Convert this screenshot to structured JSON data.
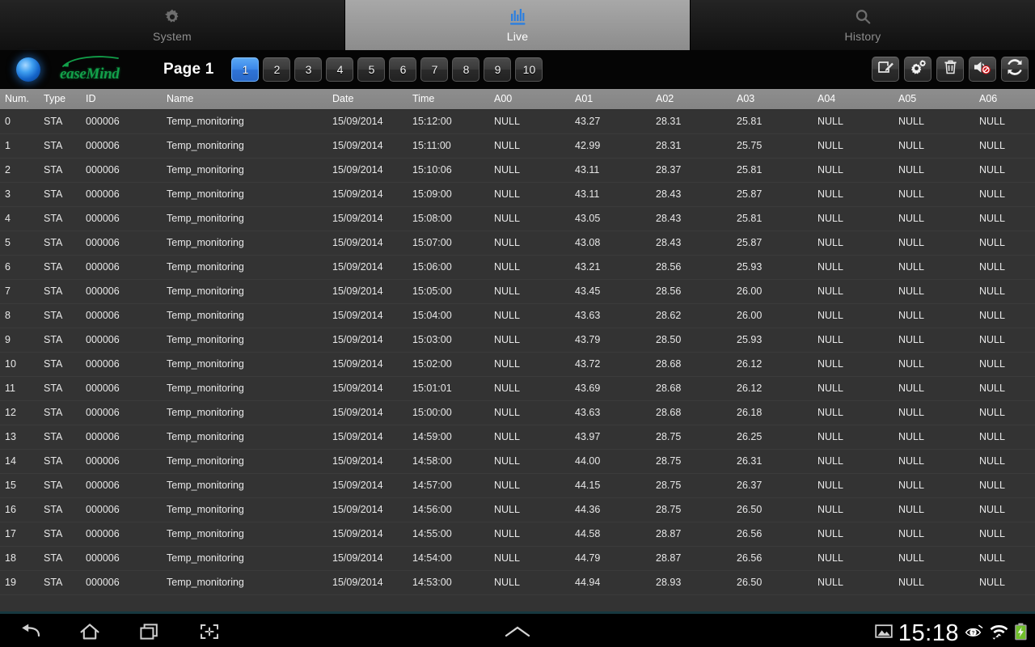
{
  "app": {
    "accent_blue": "#3b87e8",
    "logo_green": "#12a04a",
    "header_gray": "#8e8e8e",
    "row_gray": "#333333"
  },
  "tabs": [
    {
      "label": "System",
      "icon": "gear-icon",
      "active": false
    },
    {
      "label": "Live",
      "icon": "live-bars-icon",
      "active": true
    },
    {
      "label": "History",
      "icon": "magnifier-icon",
      "active": false
    }
  ],
  "toolbar": {
    "status_led": "blue-led-indicator",
    "logo_text": "easeMind",
    "page_label": "Page 1",
    "pages": [
      "1",
      "2",
      "3",
      "4",
      "5",
      "6",
      "7",
      "8",
      "9",
      "10"
    ],
    "active_page": "1",
    "tools": [
      {
        "name": "edit-note-button",
        "icon": "note-edit-icon"
      },
      {
        "name": "settings-button",
        "icon": "gears-icon"
      },
      {
        "name": "delete-button",
        "icon": "trash-icon"
      },
      {
        "name": "mute-button",
        "icon": "speaker-muted-icon"
      },
      {
        "name": "refresh-button",
        "icon": "refresh-sync-icon"
      }
    ]
  },
  "table": {
    "columns": [
      "Num.",
      "Type",
      "ID",
      "Name",
      "Date",
      "Time",
      "A00",
      "A01",
      "A02",
      "A03",
      "A04",
      "A05",
      "A06"
    ],
    "rows": [
      [
        "0",
        "STA",
        "000006",
        "Temp_monitoring",
        "15/09/2014",
        "15:12:00",
        "NULL",
        "43.27",
        "28.31",
        "25.81",
        "NULL",
        "NULL",
        "NULL"
      ],
      [
        "1",
        "STA",
        "000006",
        "Temp_monitoring",
        "15/09/2014",
        "15:11:00",
        "NULL",
        "42.99",
        "28.31",
        "25.75",
        "NULL",
        "NULL",
        "NULL"
      ],
      [
        "2",
        "STA",
        "000006",
        "Temp_monitoring",
        "15/09/2014",
        "15:10:06",
        "NULL",
        "43.11",
        "28.37",
        "25.81",
        "NULL",
        "NULL",
        "NULL"
      ],
      [
        "3",
        "STA",
        "000006",
        "Temp_monitoring",
        "15/09/2014",
        "15:09:00",
        "NULL",
        "43.11",
        "28.43",
        "25.87",
        "NULL",
        "NULL",
        "NULL"
      ],
      [
        "4",
        "STA",
        "000006",
        "Temp_monitoring",
        "15/09/2014",
        "15:08:00",
        "NULL",
        "43.05",
        "28.43",
        "25.81",
        "NULL",
        "NULL",
        "NULL"
      ],
      [
        "5",
        "STA",
        "000006",
        "Temp_monitoring",
        "15/09/2014",
        "15:07:00",
        "NULL",
        "43.08",
        "28.43",
        "25.87",
        "NULL",
        "NULL",
        "NULL"
      ],
      [
        "6",
        "STA",
        "000006",
        "Temp_monitoring",
        "15/09/2014",
        "15:06:00",
        "NULL",
        "43.21",
        "28.56",
        "25.93",
        "NULL",
        "NULL",
        "NULL"
      ],
      [
        "7",
        "STA",
        "000006",
        "Temp_monitoring",
        "15/09/2014",
        "15:05:00",
        "NULL",
        "43.45",
        "28.56",
        "26.00",
        "NULL",
        "NULL",
        "NULL"
      ],
      [
        "8",
        "STA",
        "000006",
        "Temp_monitoring",
        "15/09/2014",
        "15:04:00",
        "NULL",
        "43.63",
        "28.62",
        "26.00",
        "NULL",
        "NULL",
        "NULL"
      ],
      [
        "9",
        "STA",
        "000006",
        "Temp_monitoring",
        "15/09/2014",
        "15:03:00",
        "NULL",
        "43.79",
        "28.50",
        "25.93",
        "NULL",
        "NULL",
        "NULL"
      ],
      [
        "10",
        "STA",
        "000006",
        "Temp_monitoring",
        "15/09/2014",
        "15:02:00",
        "NULL",
        "43.72",
        "28.68",
        "26.12",
        "NULL",
        "NULL",
        "NULL"
      ],
      [
        "11",
        "STA",
        "000006",
        "Temp_monitoring",
        "15/09/2014",
        "15:01:01",
        "NULL",
        "43.69",
        "28.68",
        "26.12",
        "NULL",
        "NULL",
        "NULL"
      ],
      [
        "12",
        "STA",
        "000006",
        "Temp_monitoring",
        "15/09/2014",
        "15:00:00",
        "NULL",
        "43.63",
        "28.68",
        "26.18",
        "NULL",
        "NULL",
        "NULL"
      ],
      [
        "13",
        "STA",
        "000006",
        "Temp_monitoring",
        "15/09/2014",
        "14:59:00",
        "NULL",
        "43.97",
        "28.75",
        "26.25",
        "NULL",
        "NULL",
        "NULL"
      ],
      [
        "14",
        "STA",
        "000006",
        "Temp_monitoring",
        "15/09/2014",
        "14:58:00",
        "NULL",
        "44.00",
        "28.75",
        "26.31",
        "NULL",
        "NULL",
        "NULL"
      ],
      [
        "15",
        "STA",
        "000006",
        "Temp_monitoring",
        "15/09/2014",
        "14:57:00",
        "NULL",
        "44.15",
        "28.75",
        "26.37",
        "NULL",
        "NULL",
        "NULL"
      ],
      [
        "16",
        "STA",
        "000006",
        "Temp_monitoring",
        "15/09/2014",
        "14:56:00",
        "NULL",
        "44.36",
        "28.75",
        "26.50",
        "NULL",
        "NULL",
        "NULL"
      ],
      [
        "17",
        "STA",
        "000006",
        "Temp_monitoring",
        "15/09/2014",
        "14:55:00",
        "NULL",
        "44.58",
        "28.87",
        "26.56",
        "NULL",
        "NULL",
        "NULL"
      ],
      [
        "18",
        "STA",
        "000006",
        "Temp_monitoring",
        "15/09/2014",
        "14:54:00",
        "NULL",
        "44.79",
        "28.87",
        "26.56",
        "NULL",
        "NULL",
        "NULL"
      ],
      [
        "19",
        "STA",
        "000006",
        "Temp_monitoring",
        "15/09/2014",
        "14:53:00",
        "NULL",
        "44.94",
        "28.93",
        "26.50",
        "NULL",
        "NULL",
        "NULL"
      ]
    ]
  },
  "navbar": {
    "buttons": [
      {
        "name": "back-button",
        "icon": "back-arrow-icon"
      },
      {
        "name": "home-button",
        "icon": "home-icon"
      },
      {
        "name": "recents-button",
        "icon": "recent-apps-icon"
      },
      {
        "name": "screenshot-button",
        "icon": "screenshot-icon"
      }
    ],
    "expand": {
      "name": "expand-handle",
      "icon": "chevron-up-icon"
    },
    "status": {
      "gallery_icon": "image-icon",
      "clock": "15:18",
      "eye_icon": "eye-question-icon",
      "wifi_icon": "wifi-transfer-icon",
      "battery_icon": "battery-charging-icon"
    }
  }
}
